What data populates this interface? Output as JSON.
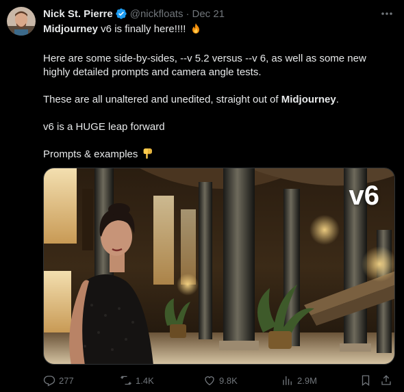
{
  "author": {
    "name": "Nick St. Pierre",
    "handle": "@nickfloats",
    "separator": "·",
    "timestamp": "Dec 21"
  },
  "tweet": {
    "line1_bold": "Midjourney",
    "line1_rest": " v6 is finally here!!!! ",
    "para2": "Here are some side-by-sides, --v 5.2 versus --v 6, as well as some new highly detailed prompts and camera angle tests.",
    "para3_start": "These are all unaltered and unedited, straight out of ",
    "para3_bold": "Midjourney",
    "para3_end": ".",
    "para4": "v6 is a HUGE leap forward",
    "para5": "Prompts & examples "
  },
  "media": {
    "label": "v6"
  },
  "actions": {
    "replies": "277",
    "reposts": "1.4K",
    "likes": "9.8K",
    "views": "2.9M"
  },
  "icons": {
    "verified": "verified-badge-icon",
    "more": "more-dots-icon",
    "fire": "fire-emoji-icon",
    "point_down": "pointing-down-emoji-icon",
    "reply": "reply-icon",
    "repost": "repost-icon",
    "like": "heart-icon",
    "views": "views-chart-icon",
    "bookmark": "bookmark-icon",
    "share": "share-icon"
  },
  "colors": {
    "background": "#000000",
    "text": "#e7e9ea",
    "muted": "#71767b",
    "verified": "#1d9bf0"
  }
}
